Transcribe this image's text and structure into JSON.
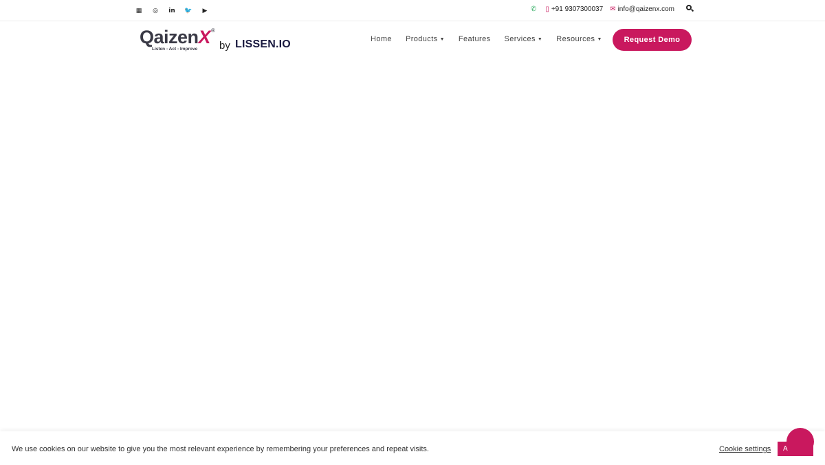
{
  "topbar": {
    "social": [
      {
        "icon": "qr-code-icon",
        "glyph": "▦"
      },
      {
        "icon": "instagram-icon",
        "glyph": "◎"
      },
      {
        "icon": "linkedin-icon",
        "glyph": "in"
      },
      {
        "icon": "twitter-icon",
        "glyph": "🐦"
      },
      {
        "icon": "youtube-icon",
        "glyph": "▶"
      }
    ],
    "phone": "+91 9307300037",
    "email": "info@qaizenx.com"
  },
  "logo": {
    "name_main": "Qaizen",
    "name_x": "X",
    "registered": "®",
    "tagline": "Listen - Act - Improve",
    "by": "by",
    "parent": "LISSEN.IO"
  },
  "nav": {
    "items": [
      {
        "label": "Home",
        "dropdown": false
      },
      {
        "label": "Products",
        "dropdown": true
      },
      {
        "label": "Features",
        "dropdown": false
      },
      {
        "label": "Services",
        "dropdown": true
      },
      {
        "label": "Resources",
        "dropdown": true
      }
    ],
    "cta": "Request Demo"
  },
  "cookie": {
    "text": "We use cookies on our website to give you the most relevant experience by remembering your preferences and repeat visits.",
    "settings": "Cookie settings",
    "accept": "A"
  },
  "colors": {
    "brand": "#c9185e",
    "whatsapp": "#25a85a",
    "text": "#333333"
  }
}
